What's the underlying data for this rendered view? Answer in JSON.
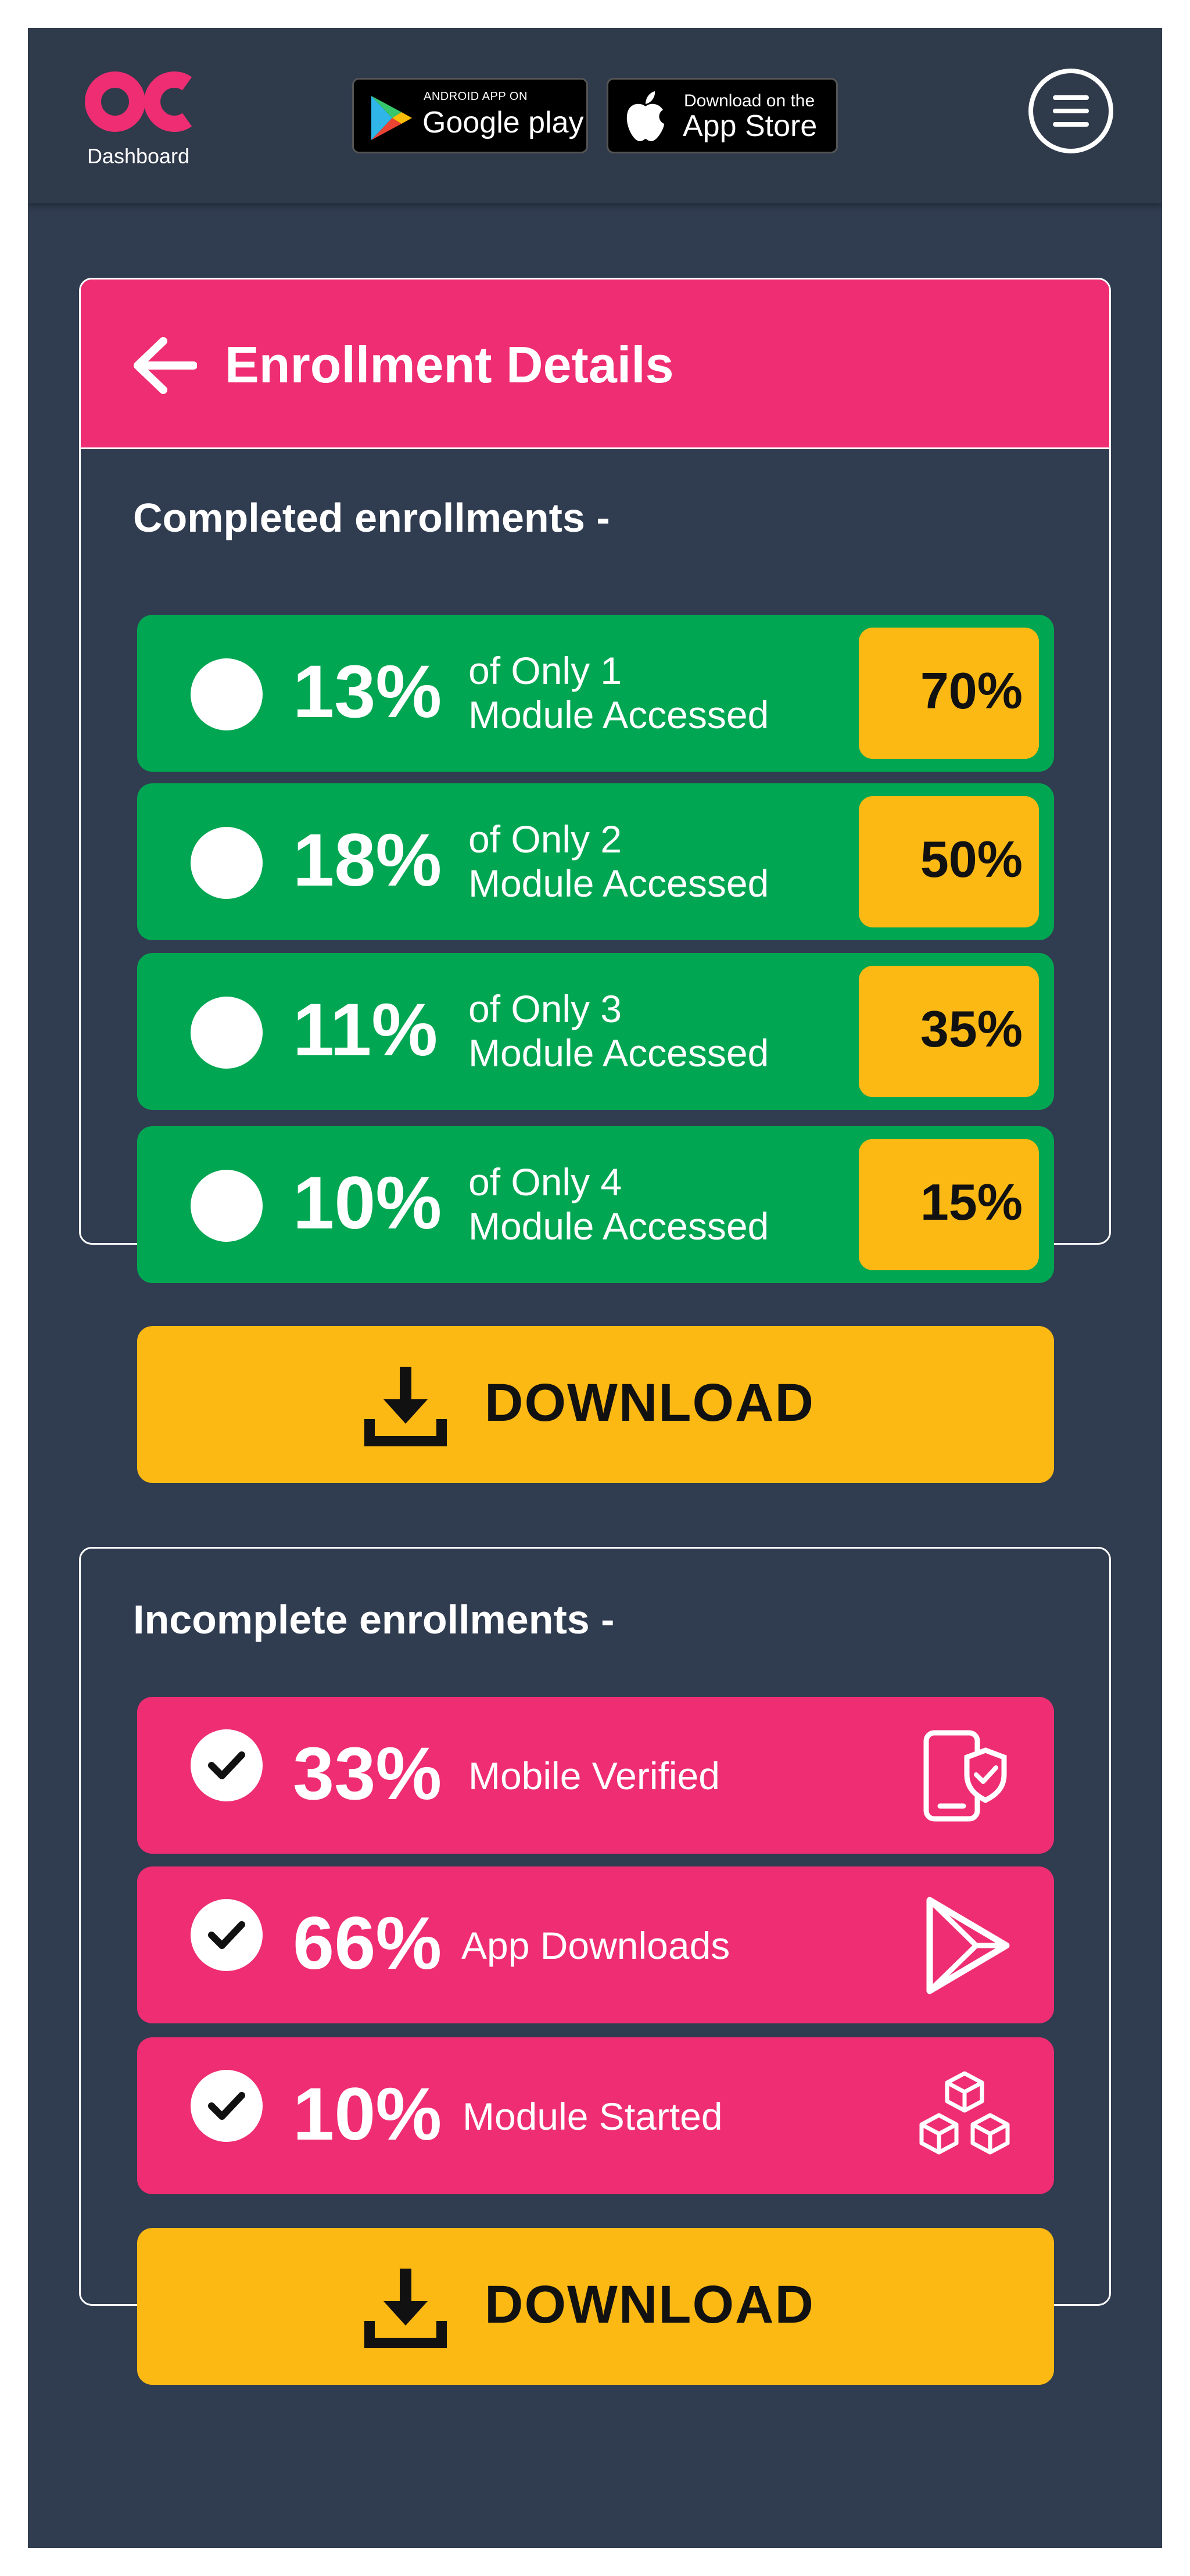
{
  "header": {
    "logo_text": "oc",
    "logo_caption": "Dashboard",
    "google_play": {
      "small": "ANDROID APP ON",
      "big": "Google play"
    },
    "app_store": {
      "small": "Download on the",
      "big": "App Store"
    },
    "menu_icon": "hamburger-menu-icon"
  },
  "page": {
    "title": "Enrollment Details",
    "back_icon": "arrow-left-icon"
  },
  "completed": {
    "title": "Completed enrollments -",
    "rows": [
      {
        "percent": "13%",
        "line1": "of Only 1",
        "line2": "Module Accessed",
        "badge": "70%"
      },
      {
        "percent": "18%",
        "line1": "of Only 2",
        "line2": "Module Accessed",
        "badge": "50%"
      },
      {
        "percent": "11%",
        "line1": "of Only 3",
        "line2": "Module Accessed",
        "badge": "35%"
      },
      {
        "percent": "10%",
        "line1": "of Only 4",
        "line2": "Module Accessed",
        "badge": "15%"
      }
    ],
    "download_label": "DOWNLOAD"
  },
  "incomplete": {
    "title": "Incomplete enrollments -",
    "rows": [
      {
        "percent": "33%",
        "label": "Mobile Verified",
        "icon": "mobile-shield-icon"
      },
      {
        "percent": "66%",
        "label": "App Downloads",
        "icon": "play-store-icon"
      },
      {
        "percent": "10%",
        "label": "Module Started",
        "icon": "cubes-icon"
      }
    ],
    "download_label": "DOWNLOAD"
  },
  "colors": {
    "background": "#303c50",
    "accent_pink": "#ef2d72",
    "row_green": "#00a651",
    "badge_yellow": "#fdb913"
  }
}
